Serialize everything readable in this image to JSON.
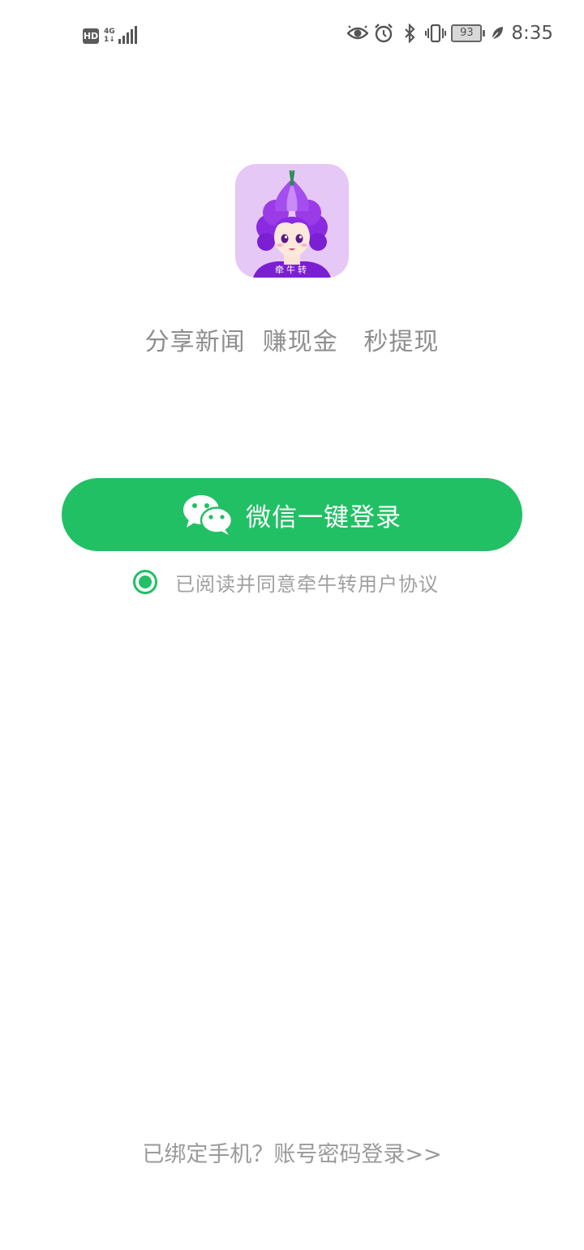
{
  "status_bar": {
    "hd_label": "HD",
    "network_type": "4G",
    "data_indicator": "1↓",
    "battery_level": "93",
    "time": "8:35",
    "icons": [
      "eye-icon",
      "alarm-icon",
      "bluetooth-icon",
      "vibrate-icon",
      "battery-icon",
      "leaf-icon"
    ]
  },
  "app": {
    "logo_caption": "牵牛转",
    "slogan": "分享新闻  赚现金   秒提现"
  },
  "login": {
    "wechat_button_label": "微信一键登录",
    "agreement_checked": true,
    "agreement_text": "已阅读并同意牵牛转用户协议",
    "account_login_link": "已绑定手机？账号密码登录>>"
  },
  "colors": {
    "accent": "#21c064",
    "logo_bg": "#e6c8f6",
    "hair": "#8a2be2",
    "text_muted": "#8e8e8e"
  }
}
